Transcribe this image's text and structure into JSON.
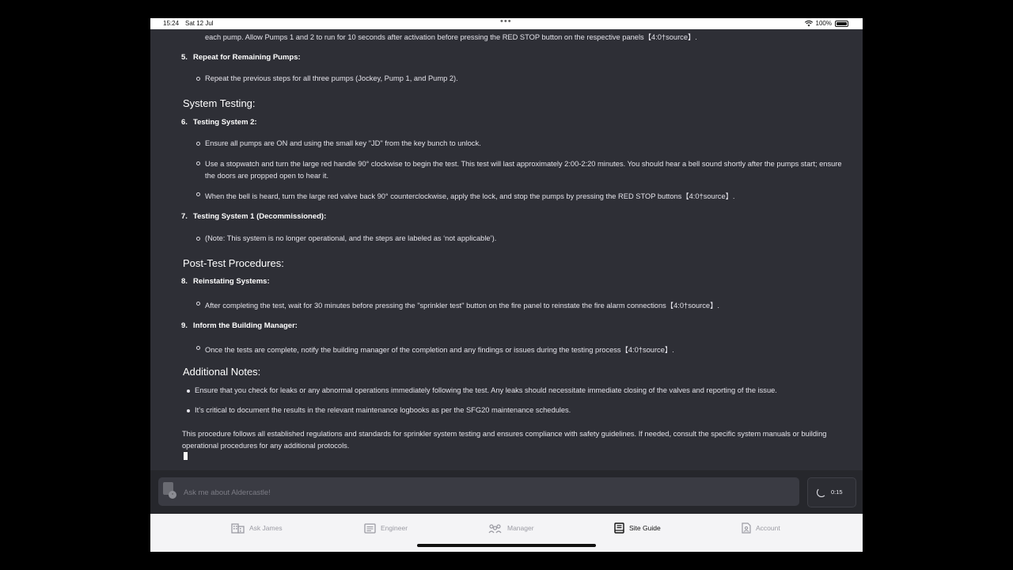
{
  "status_bar": {
    "time": "15:24",
    "date": "Sat 12 Jul",
    "battery": "100%"
  },
  "content": {
    "top_text": "each pump. Allow Pumps 1 and 2 to run for 10 seconds after activation before pressing the RED STOP button on the respective panels【4:0†source】.",
    "step5": {
      "num": "5.",
      "title": "Repeat for Remaining Pumps:",
      "bullets": [
        "Repeat the previous steps for all three pumps (Jockey, Pump 1, and Pump 2)."
      ]
    },
    "heading_system": "System Testing:",
    "step6": {
      "num": "6.",
      "title": "Testing System 2:",
      "bullets": [
        "Ensure all pumps are ON and using the small key \"JD\" from the key bunch to unlock.",
        "Use a stopwatch and turn the large red handle 90° clockwise to begin the test. This test will last approximately 2:00-2:20 minutes. You should hear a bell sound shortly after the pumps start; ensure the doors are propped open to hear it.",
        "When the bell is heard, turn the large red valve back 90° counterclockwise, apply the lock, and stop the pumps by pressing the RED STOP buttons【4:0†source】."
      ]
    },
    "step7": {
      "num": "7.",
      "title": "Testing System 1 (Decommissioned):",
      "bullets": [
        "(Note: This system is no longer operational, and the steps are labeled as ‘not applicable’)."
      ]
    },
    "heading_post": "Post-Test Procedures:",
    "step8": {
      "num": "8.",
      "title": "Reinstating Systems:",
      "bullets": [
        "After completing the test, wait for 30 minutes before pressing the \"sprinkler test\" button on the fire panel to reinstate the fire alarm connections【4:0†source】."
      ]
    },
    "step9": {
      "num": "9.",
      "title": "Inform the Building Manager:",
      "bullets": [
        "Once the tests are complete, notify the building manager of the completion and any findings or issues during the testing process【4:0†source】."
      ]
    },
    "heading_notes": "Additional Notes:",
    "notes": [
      "Ensure that you check for leaks or any abnormal operations immediately following the test. Any leaks should necessitate immediate closing of the valves and reporting of the issue.",
      "It’s critical to document the results in the relevant maintenance logbooks as per the SFG20 maintenance schedules."
    ],
    "closing": "This procedure follows all established regulations and standards for sprinkler system testing and ensures compliance with safety guidelines. If needed, consult the specific system manuals or building operational procedures for any additional protocols."
  },
  "composer": {
    "placeholder": "Ask me about Aldercastle!",
    "timer": "0:15"
  },
  "tabs": [
    {
      "label": "Ask James",
      "icon": "building-icon",
      "active": false
    },
    {
      "label": "Engineer",
      "icon": "engineer-icon",
      "active": false
    },
    {
      "label": "Manager",
      "icon": "manager-icon",
      "active": false
    },
    {
      "label": "Site Guide",
      "icon": "book-icon",
      "active": true
    },
    {
      "label": "Account",
      "icon": "account-icon",
      "active": false
    }
  ],
  "colors": {
    "background": "#2e2f36",
    "tabbar": "#f4f4f6",
    "input": "#3a3b43"
  }
}
